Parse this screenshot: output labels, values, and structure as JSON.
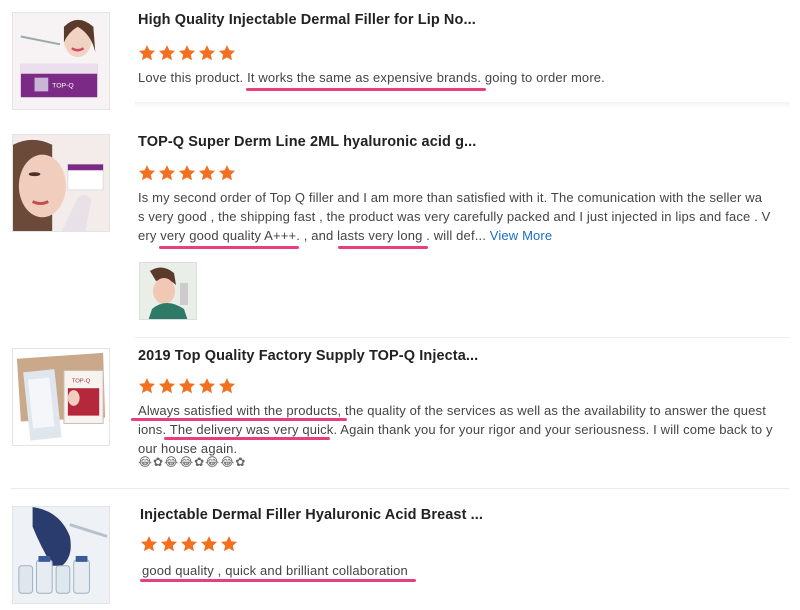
{
  "reviews": [
    {
      "title": "High Quality Injectable Dermal Filler for Lip No...",
      "rating": 5,
      "text": "Love this product.  It works the same as expensive brands.  going to order more.",
      "image": "product-thumbnail-lip-filler"
    },
    {
      "title": "TOP-Q Super Derm Line 2ML hyaluronic acid g...",
      "rating": 5,
      "line1": "Is my second order of Top Q filler and I am more than satisfied with it. The comunication with the seller wa",
      "line2": "s very good , the shipping fast , the product was very carefully packed and I just injected in lips and face . V",
      "line3": "ery very good quality A+++. , and lasts very long . will def...",
      "view_more": "View More",
      "image": "product-thumbnail-face",
      "attachment": "customer-photo-thumbnail"
    },
    {
      "title": "2019 Top Quality Factory Supply TOP-Q Injecta...",
      "rating": 5,
      "line1": "Always satisfied with the products, the quality of the services as well as the availability to answer the quest",
      "line2": "ions. The delivery was very quick. Again thank you for your rigor and your seriousness. I will come back to y",
      "line3": "our house again.",
      "emojis": "😂✿😂😂✿😂😂✿",
      "image": "product-thumbnail-box"
    },
    {
      "title": "Injectable Dermal Filler Hyaluronic Acid Breast ...",
      "rating": 5,
      "text": "good quality , quick and brilliant  collaboration",
      "image": "product-thumbnail-vials"
    }
  ],
  "colors": {
    "star": "#f2701f",
    "underline": "#e83e7f",
    "link": "#1a6dc4",
    "title": "#222222",
    "text": "#444444"
  },
  "icons": [
    "star-icon"
  ]
}
